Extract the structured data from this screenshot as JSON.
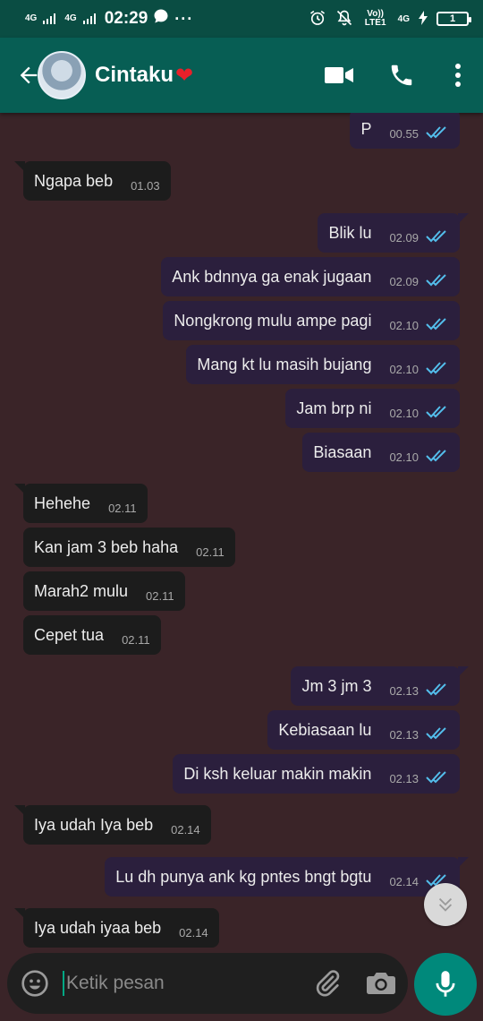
{
  "status": {
    "network1": "4G",
    "network2": "4G",
    "time": "02:29",
    "volte": "Vo)) LTE1",
    "net4g": "4G",
    "battery": "1"
  },
  "header": {
    "contact_name": "Cintaku",
    "heart": "❤"
  },
  "messages": [
    {
      "text": "P",
      "time": "00.55",
      "dir": "out"
    },
    {
      "text": "Ngapa beb",
      "time": "01.03",
      "dir": "in"
    },
    {
      "text": "Blik lu",
      "time": "02.09",
      "dir": "out"
    },
    {
      "text": "Ank bdnnya ga enak jugaan",
      "time": "02.09",
      "dir": "out"
    },
    {
      "text": "Nongkrong mulu ampe pagi",
      "time": "02.10",
      "dir": "out"
    },
    {
      "text": "Mang kt lu masih bujang",
      "time": "02.10",
      "dir": "out"
    },
    {
      "text": "Jam brp ni",
      "time": "02.10",
      "dir": "out"
    },
    {
      "text": "Biasaan",
      "time": "02.10",
      "dir": "out"
    },
    {
      "text": "Hehehe",
      "time": "02.11",
      "dir": "in"
    },
    {
      "text": "Kan jam 3 beb haha",
      "time": "02.11",
      "dir": "in"
    },
    {
      "text": "Marah2 mulu",
      "time": "02.11",
      "dir": "in"
    },
    {
      "text": "Cepet tua",
      "time": "02.11",
      "dir": "in"
    },
    {
      "text": "Jm 3 jm 3",
      "time": "02.13",
      "dir": "out"
    },
    {
      "text": "Kebiasaan lu",
      "time": "02.13",
      "dir": "out"
    },
    {
      "text": "Di ksh keluar makin makin",
      "time": "02.13",
      "dir": "out"
    },
    {
      "text": "Iya udah Iya beb",
      "time": "02.14",
      "dir": "in"
    },
    {
      "text": "Lu dh punya ank kg pntes bngt bgtu",
      "time": "02.14",
      "dir": "out"
    },
    {
      "text": "Iya udah iyaa beb",
      "time": "02.14",
      "dir": "in"
    }
  ],
  "composer": {
    "placeholder": "Ketik pesan"
  },
  "colors": {
    "header": "#075e54",
    "statusbar": "#0a4d43",
    "background": "#3a2428",
    "incoming_bubble": "#1c1c1c",
    "outgoing_bubble": "#2b1f3d",
    "read_ticks": "#53bdeb",
    "mic_button": "#00897b"
  }
}
